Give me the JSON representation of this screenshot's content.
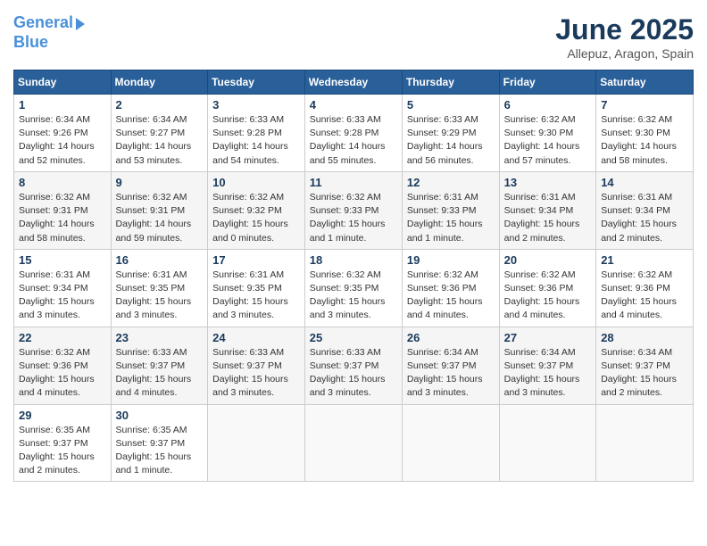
{
  "header": {
    "logo_line1": "General",
    "logo_line2": "Blue",
    "month": "June 2025",
    "location": "Allepuz, Aragon, Spain"
  },
  "weekdays": [
    "Sunday",
    "Monday",
    "Tuesday",
    "Wednesday",
    "Thursday",
    "Friday",
    "Saturday"
  ],
  "weeks": [
    [
      {
        "day": "1",
        "info": "Sunrise: 6:34 AM\nSunset: 9:26 PM\nDaylight: 14 hours\nand 52 minutes."
      },
      {
        "day": "2",
        "info": "Sunrise: 6:34 AM\nSunset: 9:27 PM\nDaylight: 14 hours\nand 53 minutes."
      },
      {
        "day": "3",
        "info": "Sunrise: 6:33 AM\nSunset: 9:28 PM\nDaylight: 14 hours\nand 54 minutes."
      },
      {
        "day": "4",
        "info": "Sunrise: 6:33 AM\nSunset: 9:28 PM\nDaylight: 14 hours\nand 55 minutes."
      },
      {
        "day": "5",
        "info": "Sunrise: 6:33 AM\nSunset: 9:29 PM\nDaylight: 14 hours\nand 56 minutes."
      },
      {
        "day": "6",
        "info": "Sunrise: 6:32 AM\nSunset: 9:30 PM\nDaylight: 14 hours\nand 57 minutes."
      },
      {
        "day": "7",
        "info": "Sunrise: 6:32 AM\nSunset: 9:30 PM\nDaylight: 14 hours\nand 58 minutes."
      }
    ],
    [
      {
        "day": "8",
        "info": "Sunrise: 6:32 AM\nSunset: 9:31 PM\nDaylight: 14 hours\nand 58 minutes."
      },
      {
        "day": "9",
        "info": "Sunrise: 6:32 AM\nSunset: 9:31 PM\nDaylight: 14 hours\nand 59 minutes."
      },
      {
        "day": "10",
        "info": "Sunrise: 6:32 AM\nSunset: 9:32 PM\nDaylight: 15 hours\nand 0 minutes."
      },
      {
        "day": "11",
        "info": "Sunrise: 6:32 AM\nSunset: 9:33 PM\nDaylight: 15 hours\nand 1 minute."
      },
      {
        "day": "12",
        "info": "Sunrise: 6:31 AM\nSunset: 9:33 PM\nDaylight: 15 hours\nand 1 minute."
      },
      {
        "day": "13",
        "info": "Sunrise: 6:31 AM\nSunset: 9:34 PM\nDaylight: 15 hours\nand 2 minutes."
      },
      {
        "day": "14",
        "info": "Sunrise: 6:31 AM\nSunset: 9:34 PM\nDaylight: 15 hours\nand 2 minutes."
      }
    ],
    [
      {
        "day": "15",
        "info": "Sunrise: 6:31 AM\nSunset: 9:34 PM\nDaylight: 15 hours\nand 3 minutes."
      },
      {
        "day": "16",
        "info": "Sunrise: 6:31 AM\nSunset: 9:35 PM\nDaylight: 15 hours\nand 3 minutes."
      },
      {
        "day": "17",
        "info": "Sunrise: 6:31 AM\nSunset: 9:35 PM\nDaylight: 15 hours\nand 3 minutes."
      },
      {
        "day": "18",
        "info": "Sunrise: 6:32 AM\nSunset: 9:35 PM\nDaylight: 15 hours\nand 3 minutes."
      },
      {
        "day": "19",
        "info": "Sunrise: 6:32 AM\nSunset: 9:36 PM\nDaylight: 15 hours\nand 4 minutes."
      },
      {
        "day": "20",
        "info": "Sunrise: 6:32 AM\nSunset: 9:36 PM\nDaylight: 15 hours\nand 4 minutes."
      },
      {
        "day": "21",
        "info": "Sunrise: 6:32 AM\nSunset: 9:36 PM\nDaylight: 15 hours\nand 4 minutes."
      }
    ],
    [
      {
        "day": "22",
        "info": "Sunrise: 6:32 AM\nSunset: 9:36 PM\nDaylight: 15 hours\nand 4 minutes."
      },
      {
        "day": "23",
        "info": "Sunrise: 6:33 AM\nSunset: 9:37 PM\nDaylight: 15 hours\nand 4 minutes."
      },
      {
        "day": "24",
        "info": "Sunrise: 6:33 AM\nSunset: 9:37 PM\nDaylight: 15 hours\nand 3 minutes."
      },
      {
        "day": "25",
        "info": "Sunrise: 6:33 AM\nSunset: 9:37 PM\nDaylight: 15 hours\nand 3 minutes."
      },
      {
        "day": "26",
        "info": "Sunrise: 6:34 AM\nSunset: 9:37 PM\nDaylight: 15 hours\nand 3 minutes."
      },
      {
        "day": "27",
        "info": "Sunrise: 6:34 AM\nSunset: 9:37 PM\nDaylight: 15 hours\nand 3 minutes."
      },
      {
        "day": "28",
        "info": "Sunrise: 6:34 AM\nSunset: 9:37 PM\nDaylight: 15 hours\nand 2 minutes."
      }
    ],
    [
      {
        "day": "29",
        "info": "Sunrise: 6:35 AM\nSunset: 9:37 PM\nDaylight: 15 hours\nand 2 minutes."
      },
      {
        "day": "30",
        "info": "Sunrise: 6:35 AM\nSunset: 9:37 PM\nDaylight: 15 hours\nand 1 minute."
      },
      {
        "day": "",
        "info": ""
      },
      {
        "day": "",
        "info": ""
      },
      {
        "day": "",
        "info": ""
      },
      {
        "day": "",
        "info": ""
      },
      {
        "day": "",
        "info": ""
      }
    ]
  ]
}
